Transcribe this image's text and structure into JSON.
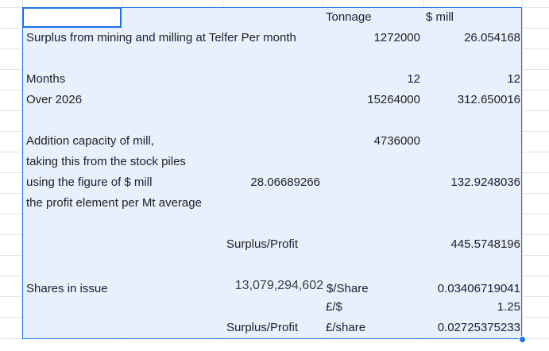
{
  "sheet": {
    "header": {
      "tonnage": "Tonnage",
      "money": "$ mill"
    },
    "rows": {
      "surplus": {
        "label": "Surplus from mining and milling at Telfer Per month",
        "tonnage": "1272000",
        "money": "26.054168"
      },
      "months": {
        "label": "Months",
        "tonnage": "12",
        "money": "12"
      },
      "over2026": {
        "label": "Over 2026",
        "tonnage": "15264000",
        "money": "312.650016"
      },
      "capacity": {
        "label": "Addition capacity of mill,",
        "tonnage": "4736000"
      },
      "stockpiles": {
        "label": "taking this from the stock piles"
      },
      "figure": {
        "label": "using the figure of $ mill",
        "value": "28.06689266",
        "money": "132.9248036"
      },
      "profit_element": {
        "label": "the profit element per Mt average"
      },
      "surplus_profit": {
        "label": "Surplus/Profit",
        "money": "445.5748196"
      },
      "shares": {
        "label": "Shares in issue",
        "value": "13,079,294,602",
        "unit": "$/Share",
        "money": "0.03406719041"
      },
      "fx": {
        "unit": "£/$",
        "money": "1.25"
      },
      "surplus_profit_gbp": {
        "label": "Surplus/Profit",
        "unit": "£/share",
        "money": "0.02725375233"
      }
    }
  }
}
